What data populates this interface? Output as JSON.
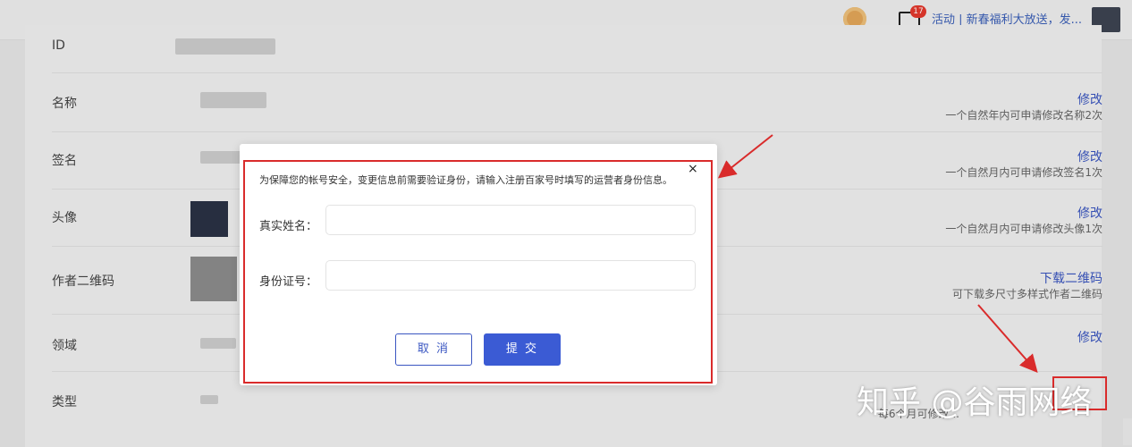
{
  "topbar": {
    "mail_count": "17",
    "notice": "活动 | 新春福利大放送，发..."
  },
  "rows": [
    {
      "label": "ID",
      "action": "",
      "hint": ""
    },
    {
      "label": "名称",
      "action": "修改",
      "hint": "一个自然年内可申请修改名称2次"
    },
    {
      "label": "签名",
      "action": "修改",
      "hint": "一个自然月内可申请修改签名1次"
    },
    {
      "label": "头像",
      "action": "修改",
      "hint": "一个自然月内可申请修改头像1次"
    },
    {
      "label": "作者二维码",
      "action": "下载二维码",
      "hint": "可下载多尺寸多样式作者二维码"
    },
    {
      "label": "领域",
      "action": "修改",
      "hint": ""
    },
    {
      "label": "类型",
      "action": "",
      "hint": "每6个月可修改..."
    }
  ],
  "modal": {
    "description": "为保障您的帐号安全，变更信息前需要验证身份，请输入注册百家号时填写的运营者身份信息。",
    "close_symbol": "×",
    "name_label": "真实姓名：",
    "name_value": "",
    "id_label": "身份证号：",
    "id_value": "",
    "cancel_label": "取 消",
    "submit_label": "提 交"
  },
  "watermark": "知乎 @谷雨网络",
  "colors": {
    "accent": "#3b5bd4",
    "link": "#3a56c1",
    "highlight_red": "#d92b2b"
  }
}
